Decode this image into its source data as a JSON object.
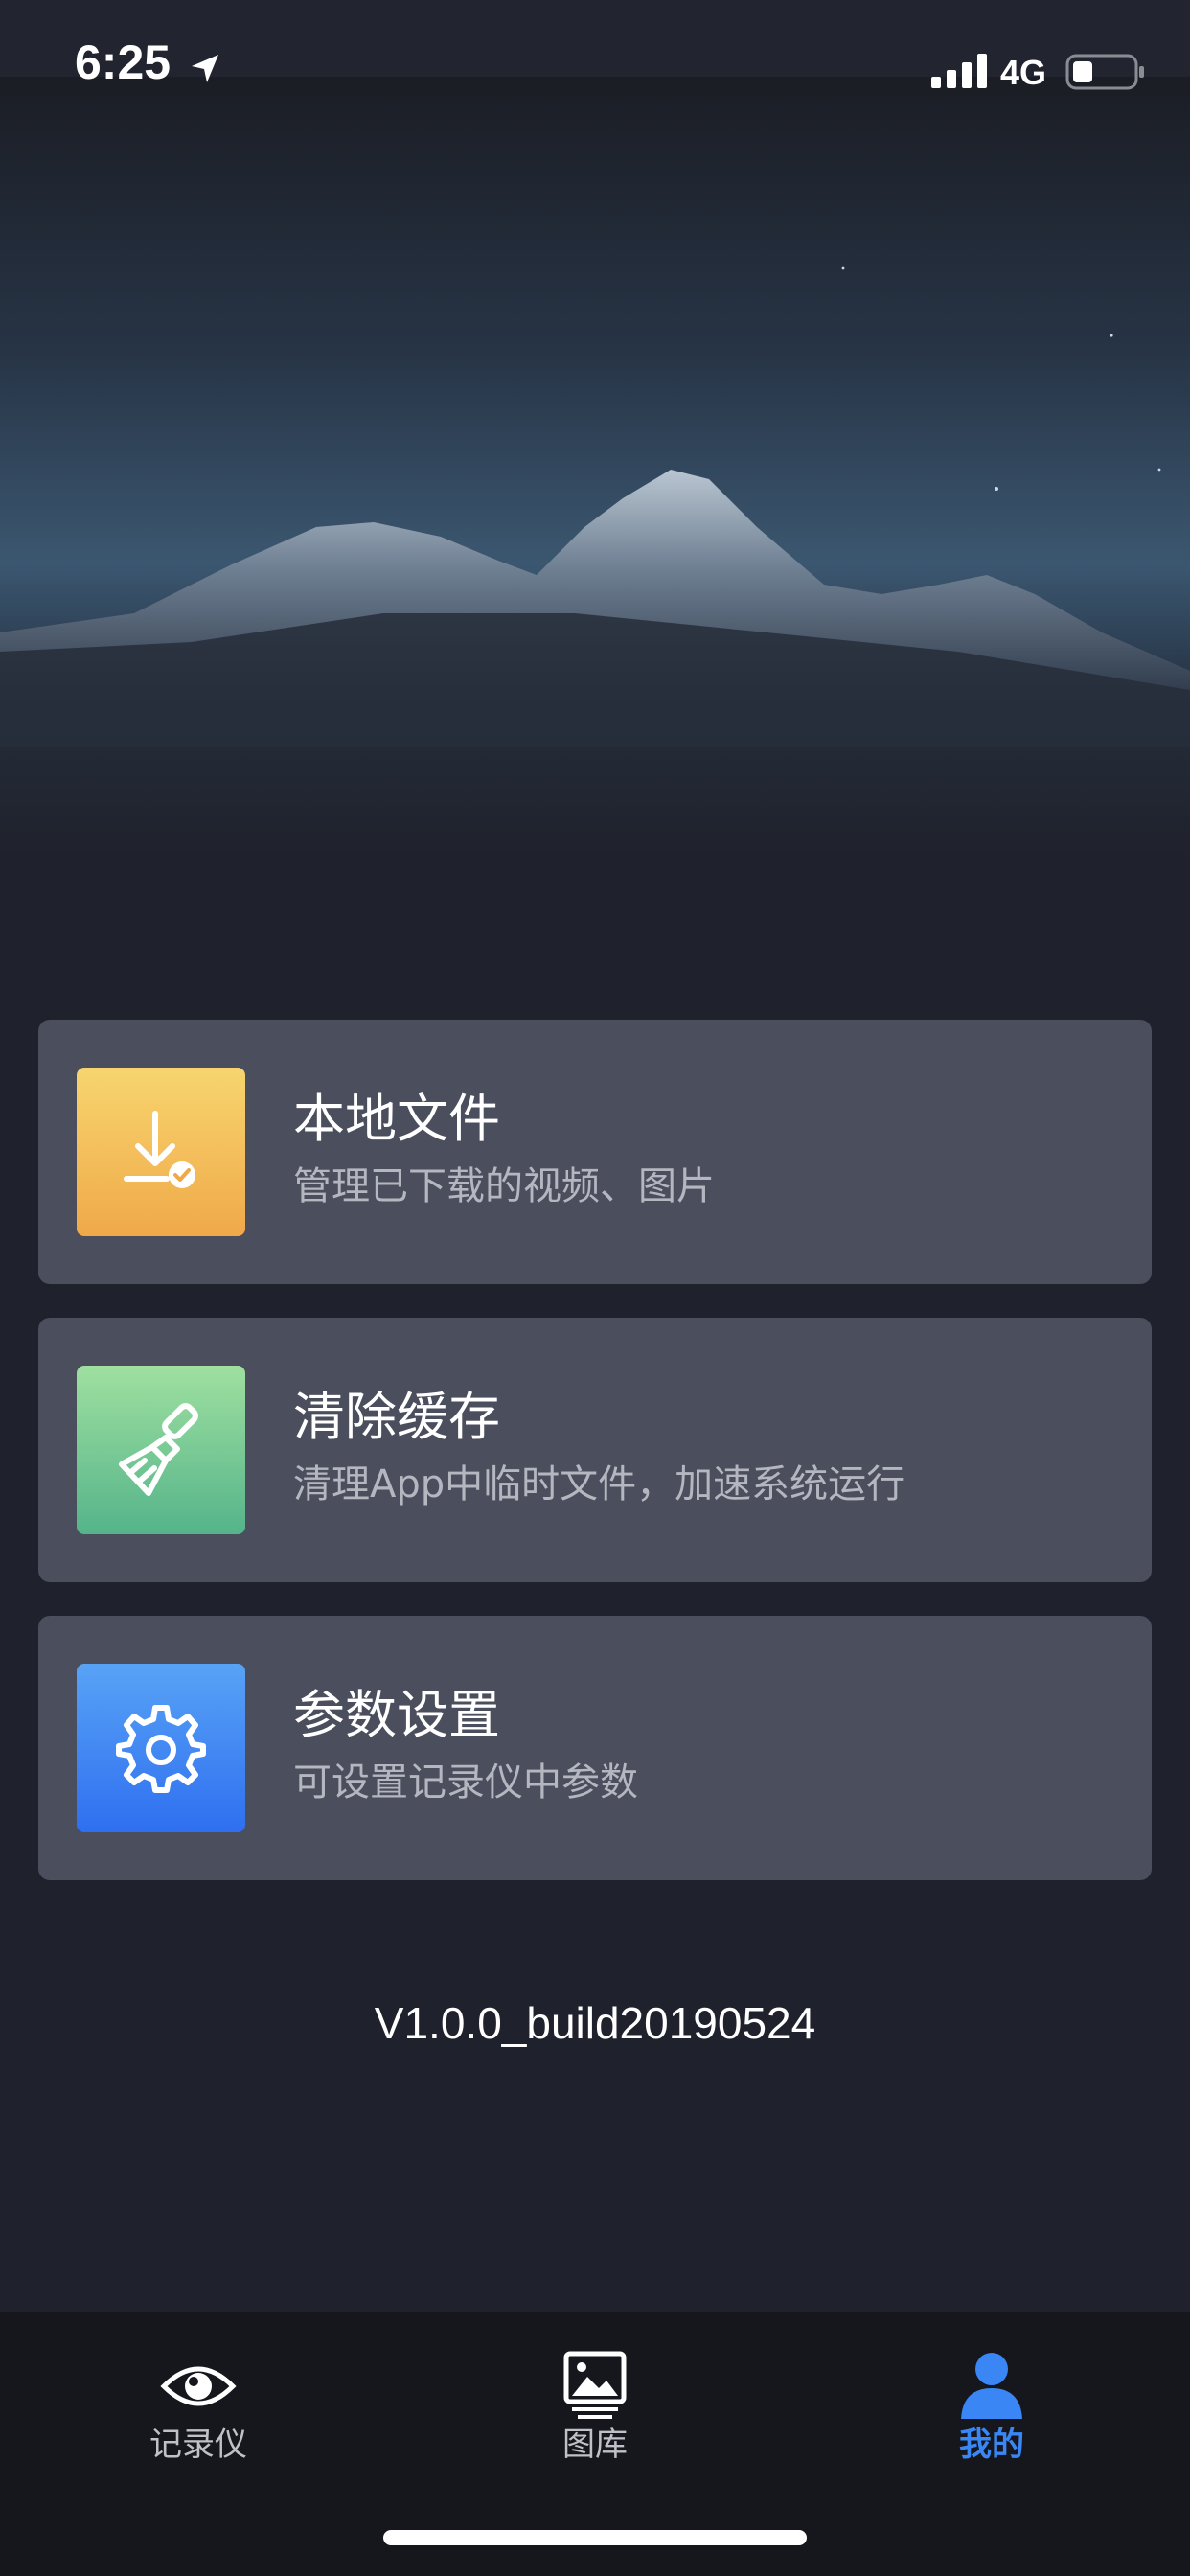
{
  "status_bar": {
    "time": "6:25",
    "network": "4G",
    "icons": [
      "location-arrow-icon",
      "signal-icon",
      "battery-icon"
    ]
  },
  "hero": {
    "image": "mountain-night-sky"
  },
  "menu": [
    {
      "title": "本地文件",
      "subtitle": "管理已下载的视频、图片",
      "icon": "download-check-icon"
    },
    {
      "title": "清除缓存",
      "subtitle": "清理App中临时文件，加速系统运行",
      "icon": "broom-icon"
    },
    {
      "title": "参数设置",
      "subtitle": "可设置记录仪中参数",
      "icon": "gear-icon"
    }
  ],
  "version": "V1.0.0_build20190524",
  "tab_bar": {
    "tabs": [
      {
        "label": "记录仪",
        "icon": "eye-icon",
        "active": false
      },
      {
        "label": "图库",
        "icon": "gallery-icon",
        "active": false
      },
      {
        "label": "我的",
        "icon": "user-icon",
        "active": true
      }
    ]
  },
  "colors": {
    "background": "#1f212c",
    "card": "#4b4e5c",
    "accent": "#3a86f5",
    "subtitle": "#b4b6c0"
  }
}
